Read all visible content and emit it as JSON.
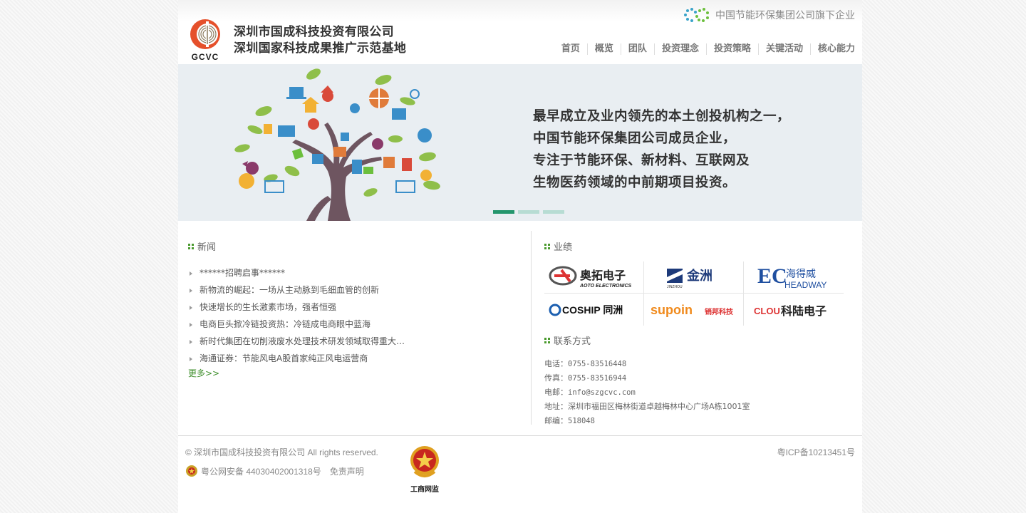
{
  "header": {
    "logo_text": "GCVC",
    "company_line1": "深圳市国成科技投资有限公司",
    "company_line2": "深圳国家科技成果推广示范基地",
    "group_tag": "中国节能环保集团公司旗下企业"
  },
  "nav": {
    "items": [
      "首页",
      "概览",
      "团队",
      "投资理念",
      "投资策略",
      "关键活动",
      "核心能力"
    ]
  },
  "banner": {
    "lines": [
      "最早成立及业内领先的本土创投机构之一，",
      "中国节能环保集团公司成员企业，",
      "专注于节能环保、新材料、互联网及",
      "生物医药领域的中前期项目投资。"
    ],
    "slides": 3,
    "active_slide": 1
  },
  "news": {
    "title": "新闻",
    "items": [
      "******招聘启事******",
      "新物流的崛起：一场从主动脉到毛细血管的创新",
      "快速增长的生长激素市场，强者恒强",
      "电商巨头掀冷链投资热：冷链成电商眼中蓝海",
      "新时代集团在切削液废水处理技术研发领域取得重大…",
      "海通证券：节能风电A股首家纯正风电运营商"
    ],
    "more": "更多>>"
  },
  "performance": {
    "title": "业绩",
    "logos": [
      {
        "name": "奥拓电子",
        "sub": "AOTO ELECTRONICS"
      },
      {
        "name": "金洲",
        "sub": "JINZHOU"
      },
      {
        "name": "海得威",
        "sub": "HEADWAY"
      },
      {
        "name": "COSHIP 同洲",
        "sub": ""
      },
      {
        "name": "supoin",
        "sub": "销邦科技"
      },
      {
        "name": "科陆电子",
        "sub": "CLOU"
      }
    ]
  },
  "contact": {
    "title": "联系方式",
    "phone_label": "电话：",
    "phone": "0755-83516448",
    "fax_label": "传真：",
    "fax": "0755-83516944",
    "email_label": "电邮：",
    "email": "info@szgcvc.com",
    "address_label": "地址：",
    "address": "深圳市福田区梅林街道卓越梅林中心广场A栋1001室",
    "zip_label": "邮编：",
    "zip": "518048"
  },
  "footer": {
    "copyright": "© 深圳市国成科技投资有限公司 All rights reserved.",
    "police": "粤公网安备 44030402001318号",
    "disclaimer": "免责声明",
    "icp": "粤ICP备10213451号",
    "badge_text": "工商网监"
  },
  "colors": {
    "accent_green": "#24966d",
    "logo_orange": "#e5502b",
    "nav_text": "#777777",
    "section_icon": "#4a9a2e"
  }
}
